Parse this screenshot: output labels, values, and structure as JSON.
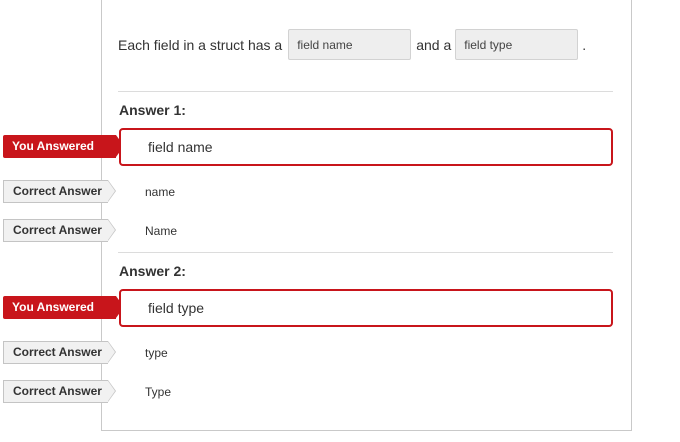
{
  "question": {
    "prefix": "Each field in a struct has a",
    "blank1": "field name",
    "middle": "and a",
    "blank2": "field type",
    "suffix": "."
  },
  "answers": [
    {
      "heading": "Answer 1:",
      "you_answered_label": "You Answered",
      "you_answered": "field name",
      "correct_label": "Correct Answer",
      "correct": [
        "name",
        "Name"
      ]
    },
    {
      "heading": "Answer 2:",
      "you_answered_label": "You Answered",
      "you_answered": "field type",
      "correct_label": "Correct Answer",
      "correct": [
        "type",
        "Type"
      ]
    }
  ],
  "colors": {
    "incorrect": "#c8151b",
    "correct_tag_bg": "#f1f1f1",
    "blank_bg": "#eeeeee"
  }
}
